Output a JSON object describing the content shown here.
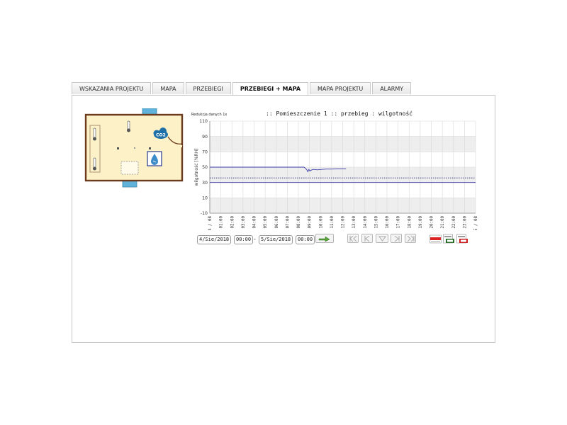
{
  "tabs": [
    {
      "label": "WSKAZANIA PROJEKTU",
      "active": false
    },
    {
      "label": "MAPA",
      "active": false
    },
    {
      "label": "PRZEBIEGI",
      "active": false
    },
    {
      "label": "PRZEBIEGI + MAPA",
      "active": true
    },
    {
      "label": "MAPA PROJEKTU",
      "active": false
    },
    {
      "label": "ALARMY",
      "active": false
    }
  ],
  "floor_plan": {
    "icons": [
      "thermometer-icon",
      "thermometer-icon",
      "thermometer-icon",
      "co2-cloud-icon",
      "humidity-drop-icon",
      "window-icon",
      "window-icon"
    ],
    "co2_label": "CO2"
  },
  "chart_header": {
    "reduction": "Redukcja danych 1x",
    "title": ":: Pomieszczenie 1 :: przebieg : wilgotność"
  },
  "colors": {
    "line": "#3a3aaa",
    "threshold": "#1a1a66",
    "band": "#eeeeee",
    "grid": "#d8d8d8"
  },
  "chart_data": {
    "type": "line",
    "ylabel": "wilgotność [%RH]",
    "ylim": [
      -10,
      110
    ],
    "y_ticks": [
      "110",
      "90",
      "70",
      "50",
      "30",
      "10",
      "-10"
    ],
    "x_ticks": [
      "04 / 08",
      "01:00",
      "02:00",
      "03:00",
      "04:00",
      "05:00",
      "06:00",
      "07:00",
      "08:00",
      "09:00",
      "10:00",
      "11:00",
      "12:00",
      "13:00",
      "14:00",
      "15:00",
      "16:00",
      "17:00",
      "18:00",
      "19:00",
      "20:00",
      "21:00",
      "22:00",
      "23:00",
      "05 / 08"
    ],
    "xlim": [
      0,
      24
    ],
    "series": [
      {
        "x": [
          0,
          8.5,
          8.6,
          8.75,
          8.85,
          8.95,
          9.05,
          9.15,
          9.3,
          9.5,
          9.7,
          10,
          10.5,
          11,
          11.5,
          12,
          12.3
        ],
        "y": [
          50,
          50,
          49,
          47,
          44,
          47,
          45,
          46,
          47,
          47,
          46.5,
          47,
          47.5,
          47.5,
          48,
          48,
          48
        ]
      }
    ],
    "threshold_dotted": 36,
    "threshold_solid": 30,
    "grid": true
  },
  "controls": {
    "date_from": "4/Sie/2018",
    "time_from": "00:00",
    "separator": "-",
    "date_to": "5/Sie/2018",
    "time_to": "00:00"
  },
  "nav_icons": [
    "skip-first-icon",
    "step-back-icon",
    "center-down-icon",
    "step-forward-icon",
    "skip-last-icon"
  ],
  "report_icons": [
    "report-icon-1",
    "report-icon-2",
    "report-icon-3"
  ]
}
